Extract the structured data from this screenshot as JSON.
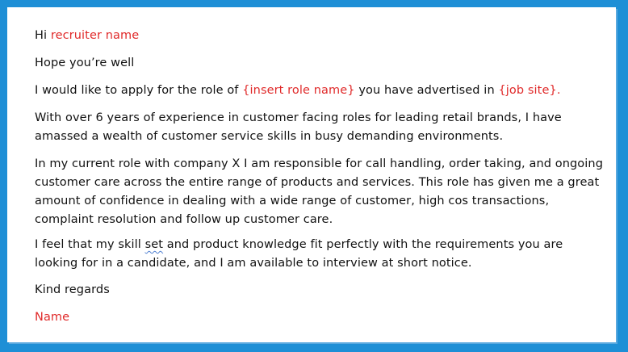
{
  "letter": {
    "greeting_prefix": "Hi ",
    "greeting_placeholder": "recruiter name",
    "hope": "Hope you’re well",
    "apply_prefix": "I would like to apply for the role of ",
    "apply_role": "{insert role name}",
    "apply_middle": " you have advertised in ",
    "apply_site": "{job site}",
    "apply_end": ".",
    "experience": "With over 6 years of experience in customer facing roles for leading retail brands, I have amassed a wealth of customer service skills in busy demanding environments.",
    "current_role": "In my current role with company X I am responsible for call handling, order taking, and ongoing customer care across the entire range of products and services. This role has given me a great amount of confidence in dealing with a wide range of customer, high cos transactions, complaint resolution and follow up customer care.",
    "skills_prefix": "I feel that my skill ",
    "skills_flagged": "set",
    "skills_rest": " and product knowledge fit perfectly with the requirements you are looking for in a candidate, and I am available to interview at short notice.",
    "closing": "Kind regards",
    "signature": "Name"
  },
  "colors": {
    "frame_border": "#1e8fd6",
    "placeholder_red": "#e02a2a",
    "spellcheck_underline": "#4f7fd1"
  }
}
